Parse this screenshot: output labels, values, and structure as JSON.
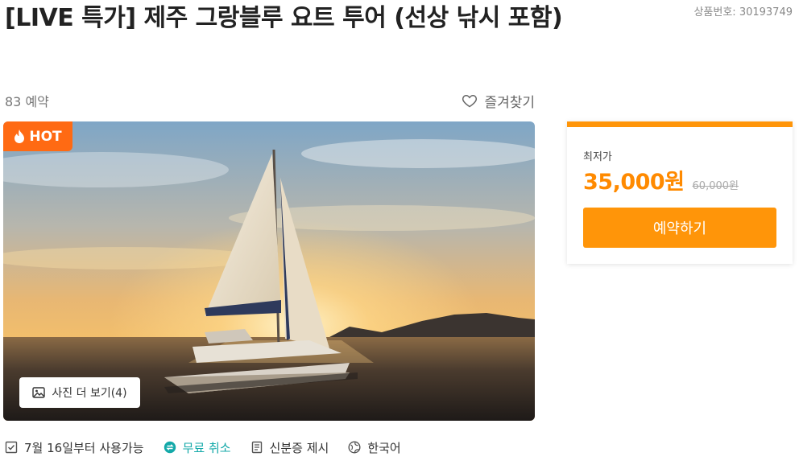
{
  "product": {
    "title": "[LIVE 특가] 제주 그랑블루 요트 투어 (선상 낚시 포함)",
    "product_number": "상품번호: 30193749",
    "booking_count": "83 예약",
    "favorite_label": "즐겨찾기"
  },
  "gallery": {
    "badge_label": "HOT",
    "more_photos_label": "사진 더 보기(4)"
  },
  "features": [
    {
      "label": "7월 16일부터 사용가능",
      "icon": "calendar-check-icon"
    },
    {
      "label": "무료 취소",
      "icon": "exchange-icon"
    },
    {
      "label": "신분증 제시",
      "icon": "document-icon"
    },
    {
      "label": "한국어",
      "icon": "globe-icon"
    }
  ],
  "price_card": {
    "label": "최저가",
    "price": "35,000원",
    "original_price": "60,000원",
    "book_button": "예약하기"
  },
  "colors": {
    "accent_orange": "#ff9509",
    "hot_badge": "#ff6a13",
    "price_text": "#ff8a00",
    "free_cancel_teal": "#14a9a9"
  }
}
